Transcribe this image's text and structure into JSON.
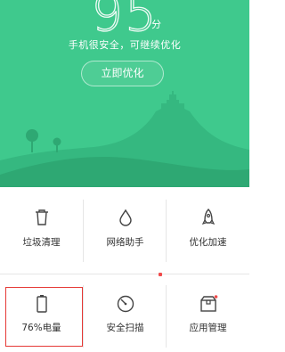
{
  "header": {
    "score": "95",
    "score_unit": "分",
    "status_text": "手机很安全，可继续优化",
    "optimize_button": "立即优化"
  },
  "tools": [
    {
      "label": "垃圾清理",
      "icon": "trash-icon"
    },
    {
      "label": "网络助手",
      "icon": "water-drop-icon"
    },
    {
      "label": "优化加速",
      "icon": "rocket-icon"
    },
    {
      "label": "76%电量",
      "icon": "battery-icon"
    },
    {
      "label": "安全扫描",
      "icon": "scan-icon"
    },
    {
      "label": "应用管理",
      "icon": "app-box-icon"
    }
  ],
  "colors": {
    "hero_green": "#3fc98d",
    "highlight_red": "#e53935",
    "badge_red": "#f04a4a"
  }
}
